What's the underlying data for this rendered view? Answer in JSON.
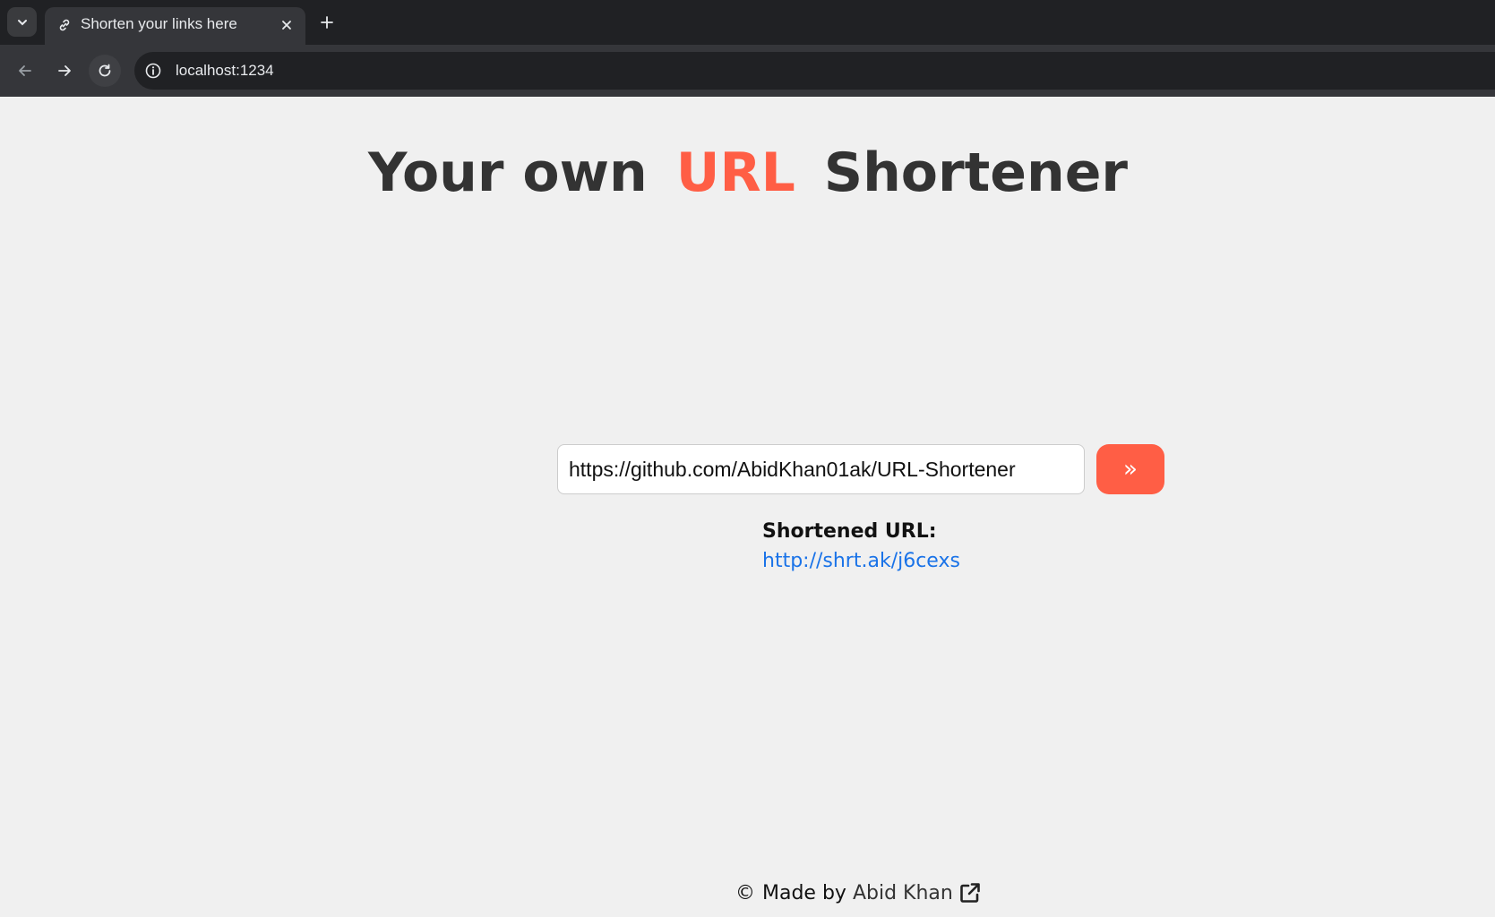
{
  "browser": {
    "tab_title": "Shorten your links here",
    "url": "localhost:1234",
    "icons": {
      "tab_list": "chevron-down-icon",
      "favicon": "link-icon",
      "close": "close-icon",
      "new_tab": "plus-icon",
      "back": "arrow-left-icon",
      "forward": "arrow-right-icon",
      "reload": "reload-icon",
      "site_info": "info-icon"
    }
  },
  "header": {
    "title_part1": "Your own",
    "title_accent": "URL",
    "title_part2": "Shortener"
  },
  "form": {
    "input_value": "https://github.com/AbidKhan01ak/URL-Shortener",
    "submit_label": "»"
  },
  "result": {
    "label": "Shortened URL:",
    "link": "http://shrt.ak/j6cexs"
  },
  "footer": {
    "copyright": "©",
    "made_by": "Made by",
    "author": "Abid Khan",
    "icon": "external-link-icon"
  },
  "colors": {
    "accent": "#ff5e45",
    "link": "#1a73e8",
    "page_bg": "#f0f0f0",
    "heading": "#333333"
  }
}
